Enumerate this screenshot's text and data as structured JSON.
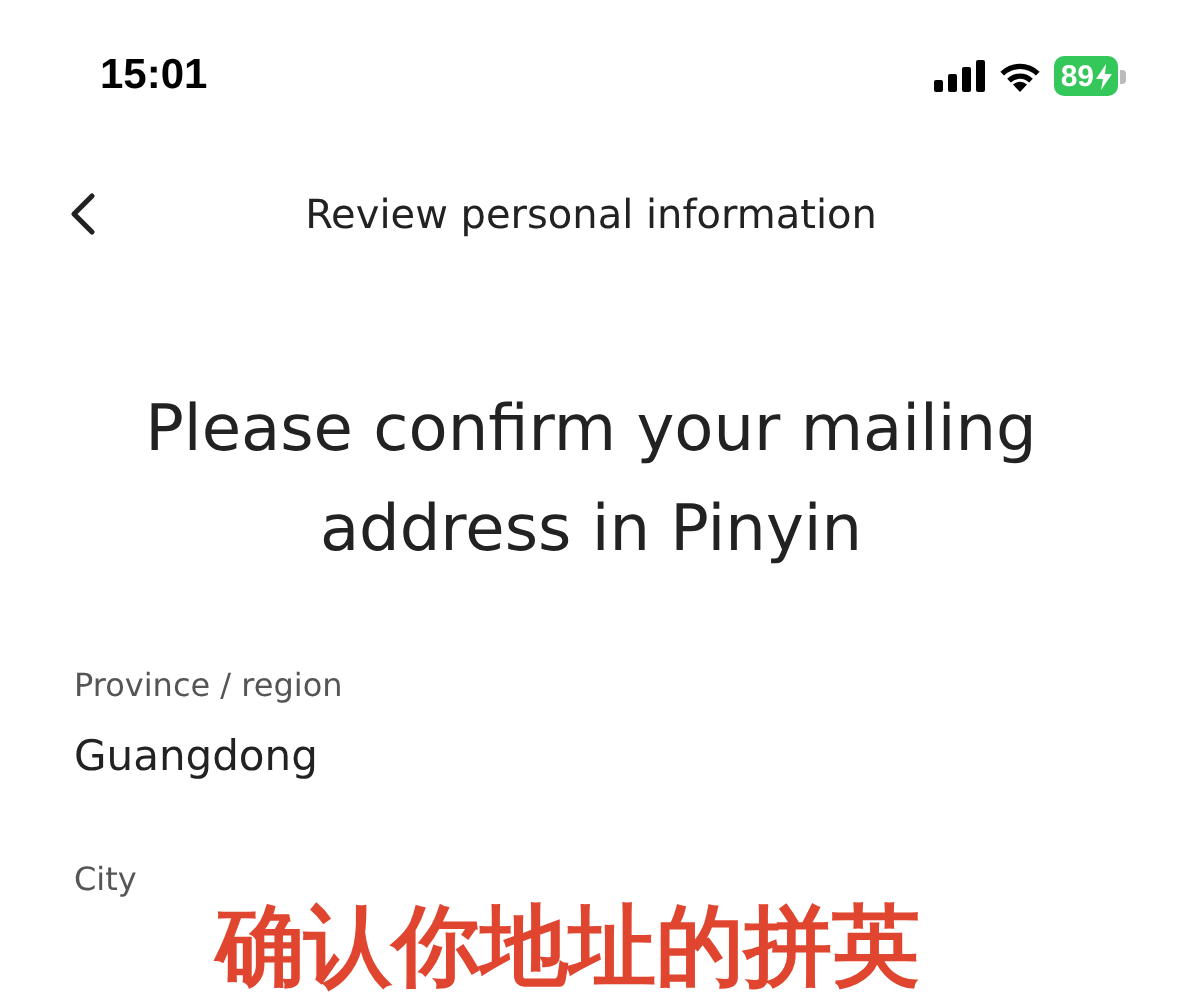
{
  "status_bar": {
    "time": "15:01",
    "battery": "89"
  },
  "nav_bar": {
    "title": "Review personal information"
  },
  "heading": "Please confirm your mailing address in Pinyin",
  "fields": [
    {
      "label": "Province / region",
      "value": "Guangdong"
    },
    {
      "label": "City"
    }
  ],
  "caption": "确认你地址的拼英"
}
